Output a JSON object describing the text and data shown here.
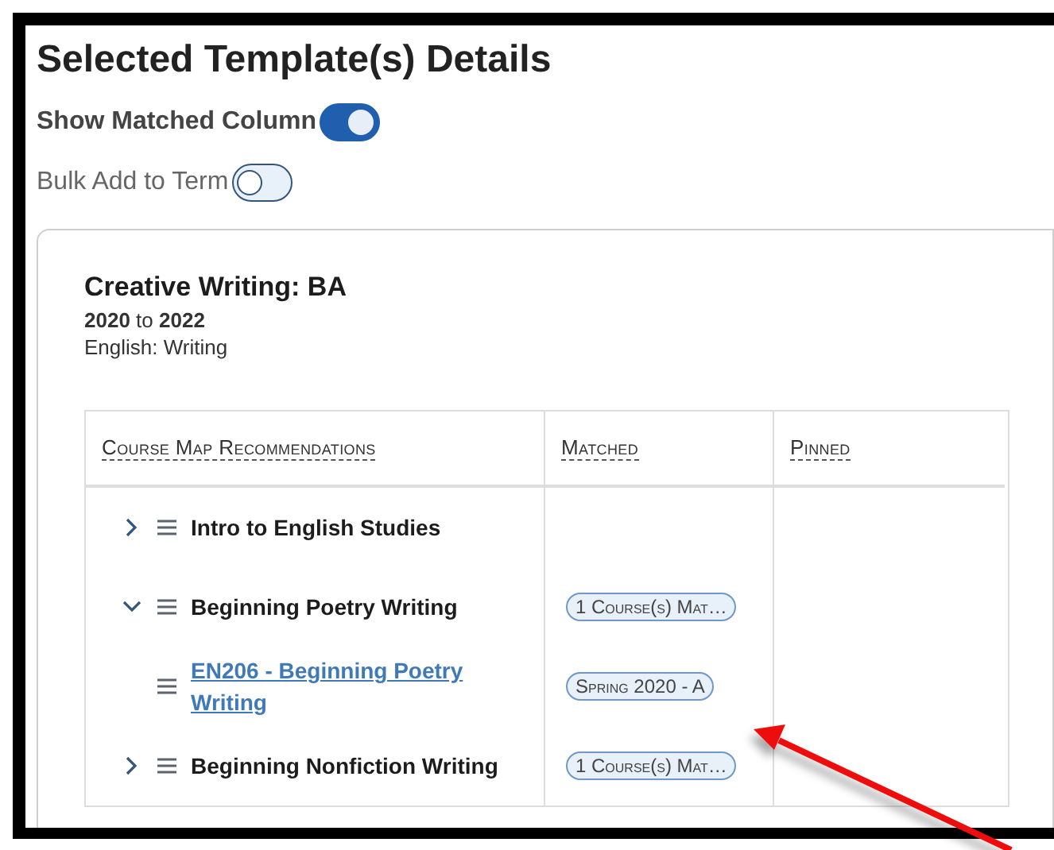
{
  "page": {
    "title": "Selected Template(s) Details"
  },
  "toggles": [
    {
      "label": "Show Matched Column",
      "on": true
    },
    {
      "label": "Bulk Add to Term",
      "on": false
    }
  ],
  "template": {
    "name": "Creative Writing: BA",
    "start_year": "2020",
    "joiner": "to",
    "end_year": "2022",
    "department": "English: Writing"
  },
  "table": {
    "columns": [
      "Course Map Recommendations",
      "Matched",
      "Pinned"
    ],
    "rows": [
      {
        "kind": "group",
        "label": "Intro to English Studies",
        "expanded": false
      },
      {
        "kind": "group",
        "label": "Beginning Poetry Writing",
        "expanded": true,
        "matched": "1 Course(s) Mat…",
        "children": [
          {
            "kind": "course",
            "label": "EN206 - Beginning Poetry Writing",
            "matched": "Spring 2020 - A"
          }
        ]
      },
      {
        "kind": "group",
        "label": "Beginning Nonfiction Writing",
        "expanded": false,
        "matched": "1 Course(s) Mat…"
      }
    ]
  }
}
